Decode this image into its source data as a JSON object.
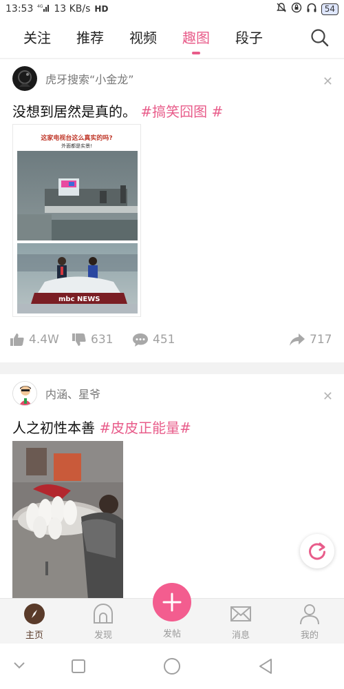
{
  "status": {
    "time": "13:53",
    "net": "4G",
    "speed": "13 KB/s",
    "hd": "HD",
    "battery": "54"
  },
  "tabs": [
    "关注",
    "推荐",
    "视频",
    "趣图",
    "段子"
  ],
  "active_tab": "趣图",
  "posts": [
    {
      "author": "虎牙搜索“小金龙”",
      "text": "没想到居然是真的。",
      "hashtag": "#搞笑囧图 #",
      "image_title": "这家电视台这么真实的吗?",
      "image_subtitle": "外面都是实景!",
      "image_logo": "mbc NEWS",
      "likes": "4.4W",
      "dislikes": "631",
      "comments": "451",
      "shares": "717"
    },
    {
      "author": "内涵、星爷",
      "text": "人之初性本善",
      "hashtag": "#皮皮正能量#"
    }
  ],
  "bottom_nav": {
    "home": "主页",
    "discover": "发现",
    "post": "发帖",
    "messages": "消息",
    "me": "我的"
  },
  "colors": {
    "accent": "#e85c8a",
    "post_button": "#f35d8f",
    "active_nav": "#5a3b2a"
  }
}
